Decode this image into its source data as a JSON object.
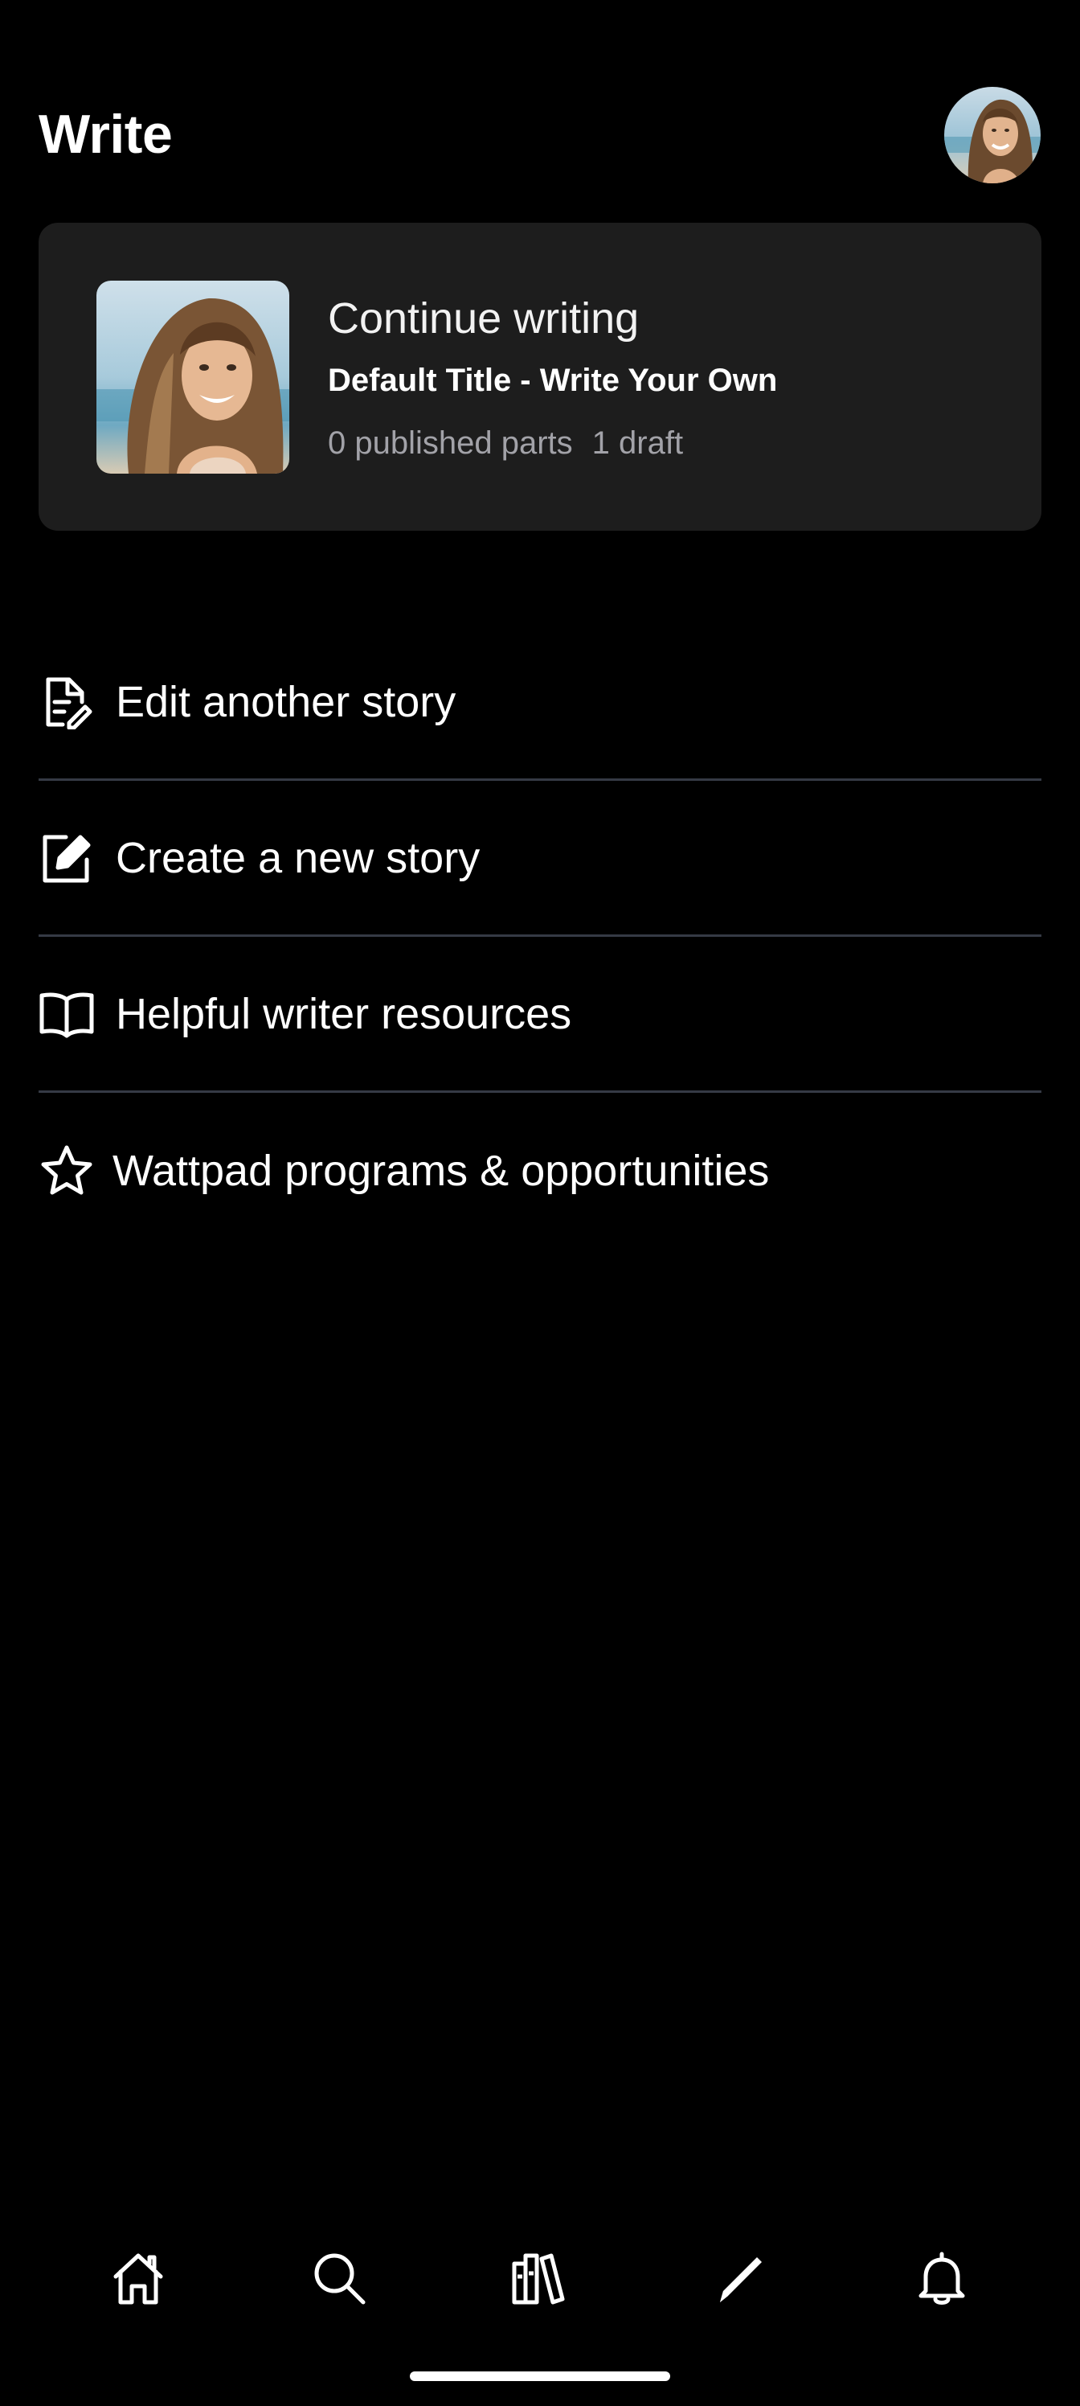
{
  "header": {
    "title": "Write"
  },
  "continue_card": {
    "label": "Continue writing",
    "story_title": "Default Title - Write Your Own",
    "published_parts": "0 published parts",
    "drafts": "1 draft"
  },
  "menu": {
    "items": [
      {
        "label": "Edit another story",
        "icon": "edit-document-icon"
      },
      {
        "label": "Create a new story",
        "icon": "compose-icon"
      },
      {
        "label": "Helpful writer resources",
        "icon": "book-icon"
      },
      {
        "label": "Wattpad programs & opportunities",
        "icon": "star-icon"
      }
    ]
  },
  "bottom_nav": {
    "items": [
      {
        "icon": "home-icon"
      },
      {
        "icon": "search-icon"
      },
      {
        "icon": "library-icon"
      },
      {
        "icon": "write-pencil-icon",
        "active": true
      },
      {
        "icon": "notifications-bell-icon"
      }
    ]
  },
  "colors": {
    "background": "#000000",
    "card": "#1d1d1d",
    "divider": "#353a45",
    "meta_text": "#a2a2a8"
  }
}
